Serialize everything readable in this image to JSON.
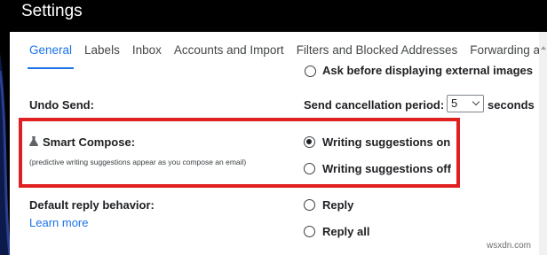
{
  "header": {
    "title": "Settings"
  },
  "tabs": [
    {
      "label": "General"
    },
    {
      "label": "Labels"
    },
    {
      "label": "Inbox"
    },
    {
      "label": "Accounts and Import"
    },
    {
      "label": "Filters and Blocked Addresses"
    },
    {
      "label": "Forwarding and"
    }
  ],
  "rows": {
    "prev_option": {
      "label": "Ask before displaying external images"
    },
    "undo_send": {
      "title": "Undo Send:",
      "period_label": "Send cancellation period:",
      "period_value": "5",
      "unit": "seconds"
    },
    "smart_compose": {
      "title": "Smart Compose:",
      "hint": "(predictive writing suggestions appear as you compose an email)",
      "option_on": "Writing suggestions on",
      "option_off": "Writing suggestions off",
      "selected": "on"
    },
    "default_reply": {
      "title": "Default reply behavior:",
      "learn_more": "Learn more",
      "option_reply": "Reply",
      "option_reply_all": "Reply all"
    }
  },
  "watermark": "wsxdn.com",
  "colors": {
    "accent": "#1a73e8",
    "highlight_box": "#e02020"
  }
}
